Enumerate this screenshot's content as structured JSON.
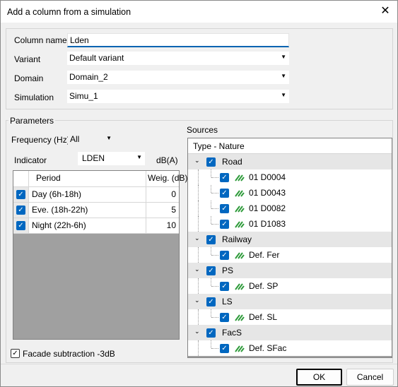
{
  "window": {
    "title": "Add a column from a simulation"
  },
  "form": {
    "column_name_label": "Column name",
    "column_name_value": "Lden",
    "variant_label": "Variant",
    "variant_value": "Default variant",
    "domain_label": "Domain",
    "domain_value": "Domain_2",
    "simulation_label": "Simulation",
    "simulation_value": "Simu_1"
  },
  "parameters": {
    "group_title": "Parameters",
    "frequency_label": "Frequency (Hz)",
    "frequency_value": "All",
    "indicator_label": "Indicator",
    "indicator_value": "LDEN",
    "unit": "dB(A)",
    "grid": {
      "headers": {
        "period": "Period",
        "weight": "Weig. (dB)"
      },
      "rows": [
        {
          "period": "Day (6h-18h)",
          "weight": "0"
        },
        {
          "period": "Eve. (18h-22h)",
          "weight": "5"
        },
        {
          "period": "Night (22h-6h)",
          "weight": "10"
        }
      ]
    },
    "facade_label": "Facade subtraction -3dB"
  },
  "sources": {
    "group_title": "Sources",
    "header": "Type - Nature",
    "groups": [
      {
        "label": "Road",
        "children": [
          "01 D0004",
          "01 D0043",
          "01 D0082",
          "01 D1083"
        ]
      },
      {
        "label": "Railway",
        "children": [
          "Def. Fer"
        ]
      },
      {
        "label": "PS",
        "children": [
          "Def. SP"
        ]
      },
      {
        "label": "LS",
        "children": [
          "Def. SL"
        ]
      },
      {
        "label": "FacS",
        "children": [
          "Def. SFac"
        ]
      }
    ]
  },
  "buttons": {
    "ok": "OK",
    "cancel": "Cancel"
  },
  "glyphs": {
    "check": "✓",
    "close": "✕",
    "dropdown": "▼",
    "expanded": "⌄"
  },
  "colors": {
    "accent": "#0067c0",
    "source_icon": "#2e9b3a"
  }
}
